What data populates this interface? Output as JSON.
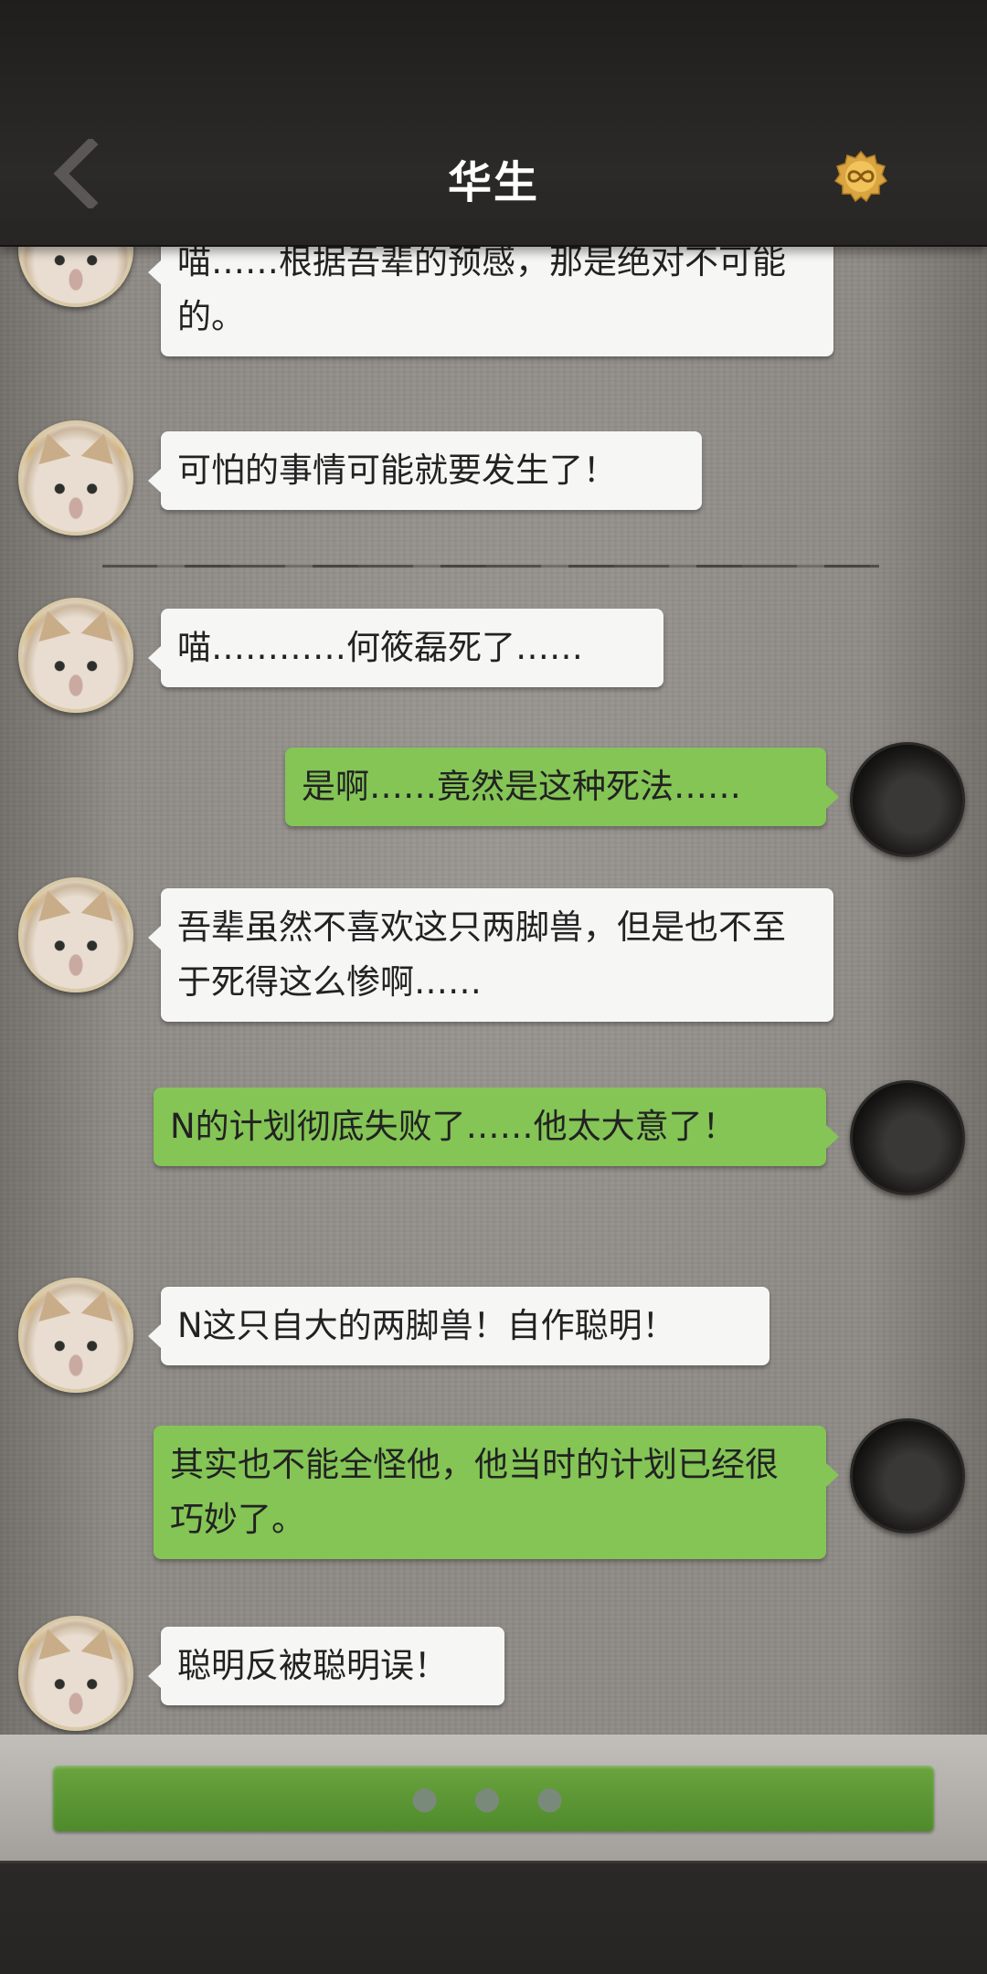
{
  "header": {
    "title": "华生",
    "back_icon": "chevron-left-icon",
    "medal_icon": "infinity-medal-icon"
  },
  "messages": [
    {
      "side": "left",
      "text": "喵……根据吾辈的预感，那是绝对不可能的。"
    },
    {
      "side": "left",
      "text": "可怕的事情可能就要发生了！"
    },
    {
      "side": "left",
      "text": "喵…………何筱磊死了……"
    },
    {
      "side": "right",
      "text": "是啊……竟然是这种死法……"
    },
    {
      "side": "left",
      "text": "吾辈虽然不喜欢这只两脚兽，但是也不至于死得这么惨啊……"
    },
    {
      "side": "right",
      "text": "N的计划彻底失败了……他太大意了！"
    },
    {
      "side": "left",
      "text": "N这只自大的两脚兽！自作聪明！"
    },
    {
      "side": "right",
      "text": "其实也不能全怪他，他当时的计划已经很巧妙了。"
    },
    {
      "side": "left",
      "text": "聪明反被聪明误！"
    }
  ],
  "input": {
    "label": "● ● ●"
  },
  "colors": {
    "left_bubble": "#f6f6f5",
    "right_bubble": "#84c556",
    "action_button": "#5c9836"
  }
}
